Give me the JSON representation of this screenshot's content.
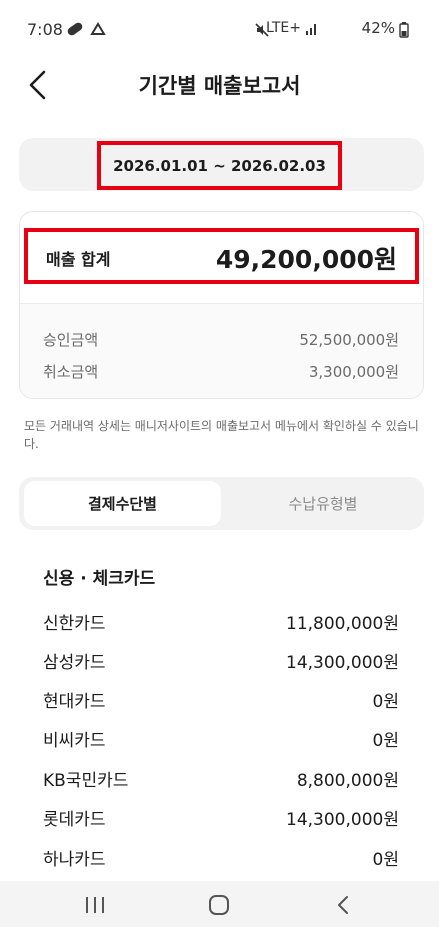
{
  "status": {
    "time": "7:08",
    "network": "LTE+",
    "battery": "42%"
  },
  "header": {
    "title": "기간별 매출보고서"
  },
  "period": {
    "range": "2026.01.01 ~ 2026.02.03"
  },
  "summary": {
    "total_label": "매출 합계",
    "total_value": "49,200,000원",
    "approved_label": "승인금액",
    "approved_value": "52,500,000원",
    "cancelled_label": "취소금액",
    "cancelled_value": "3,300,000원"
  },
  "notice": "모든 거래내역 상세는 매니저사이트의 매출보고서 메뉴에서 확인하실 수 있습니다.",
  "tabs": {
    "active": "결제수단별",
    "inactive": "수납유형별"
  },
  "section": {
    "title": "신용 · 체크카드",
    "rows": [
      {
        "label": "신한카드",
        "value": "11,800,000원"
      },
      {
        "label": "삼성카드",
        "value": "14,300,000원"
      },
      {
        "label": "현대카드",
        "value": "0원"
      },
      {
        "label": "비씨카드",
        "value": "0원"
      },
      {
        "label": "KB국민카드",
        "value": "8,800,000원"
      },
      {
        "label": "롯데카드",
        "value": "14,300,000원"
      },
      {
        "label": "하나카드",
        "value": "0원"
      }
    ]
  },
  "colors": {
    "highlight": "#e60012",
    "panel": "#f2f2f2",
    "text": "#1c1c1c",
    "muted": "#6b6b6b"
  },
  "icons": [
    "pill-icon",
    "triangle-icon",
    "mute-icon",
    "signal-icon",
    "battery-icon",
    "back-arrow-icon",
    "recents-icon",
    "home-icon",
    "nav-back-icon"
  ]
}
